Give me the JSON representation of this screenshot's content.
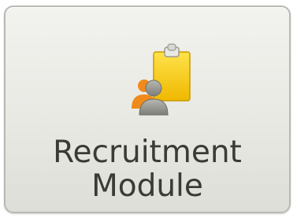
{
  "module_tile": {
    "line1": "Recruitment",
    "line2": "Module",
    "icon": "recruitment-clipboard-person-icon",
    "colors": {
      "background": "#eaeae5",
      "border": "#b9b9b4",
      "text": "#3a3a36",
      "clipboard_yellow": "#f5cf1c",
      "person_gray": "#9a9a94"
    }
  }
}
